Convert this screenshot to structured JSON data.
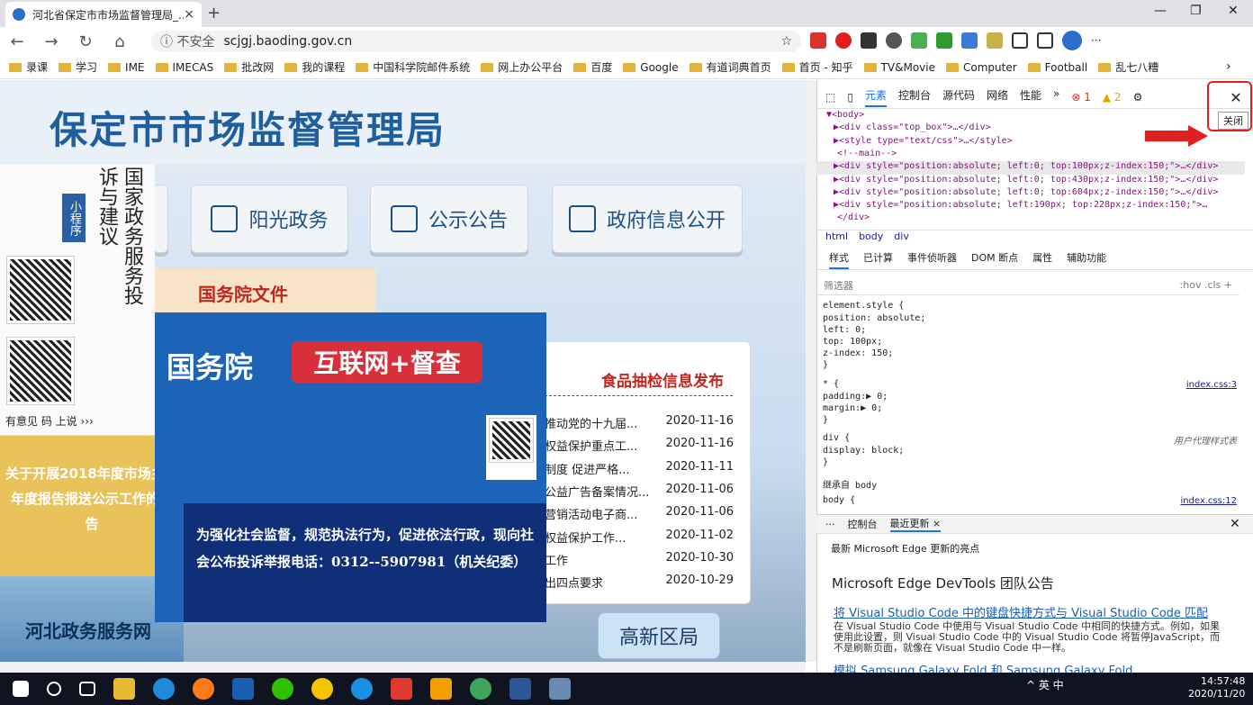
{
  "browser": {
    "tab_title": "河北省保定市市场监督管理局_...",
    "tab_close": "×",
    "new_tab": "+",
    "win_min": "—",
    "win_max": "❐",
    "win_close": "✕",
    "back": "←",
    "forward": "→",
    "refresh": "↻",
    "home": "⌂",
    "insecure": "ⓘ 不安全",
    "url": "scjgj.baoding.gov.cn",
    "star": "☆",
    "more": "···",
    "bookmarks": [
      "录课",
      "学习",
      "IME",
      "IMECAS",
      "批改网",
      "我的课程",
      "中国科学院邮件系统",
      "网上办公平台",
      "百度",
      "Google",
      "有道词典首页",
      "首页 - 知乎",
      "TV&Movie",
      "Computer",
      "Football",
      "乱七八糟"
    ],
    "bookmarks_more": "›"
  },
  "page": {
    "title": "保定市市场监督管理局",
    "nav": [
      "阳光政务",
      "公示公告",
      "政府信息公开"
    ],
    "mini_program": "小程序",
    "left_heading": "国家政务服务投诉与建议",
    "yijian": "有意见  码 上说 ›››",
    "announcement": "关于开展2018年度市场主体年度报告报送公示工作的公告",
    "hebei": "河北政务服务网",
    "gwy_wenjian": "国务院文件",
    "popup_title": "国务院",
    "popup_tag": "互联网+督查",
    "popup_text": "为强化社会监督，规范执法行为，促进依法行政，现向社会公布投诉举报电话：0312--5907981（机关纪委）",
    "news_heading": "食品抽检信息发布",
    "news": [
      {
        "title": "推动党的十九届...",
        "date": "2020-11-16"
      },
      {
        "title": "权益保护重点工...",
        "date": "2020-11-16"
      },
      {
        "title": "制度 促进严格...",
        "date": "2020-11-11"
      },
      {
        "title": "公益广告备案情况...",
        "date": "2020-11-06"
      },
      {
        "title": "营销活动电子商...",
        "date": "2020-11-06"
      },
      {
        "title": "权益保护工作...",
        "date": "2020-11-02"
      },
      {
        "title": "工作",
        "date": "2020-10-30"
      },
      {
        "title": "出四点要求",
        "date": "2020-10-29"
      }
    ],
    "gaoxin": "高新区局"
  },
  "devtools": {
    "tabs": [
      "元素",
      "控制台",
      "源代码",
      "网络",
      "性能",
      "»"
    ],
    "errors": "⊗ 1",
    "warnings": "▲ 2",
    "close_tooltip": "关闭",
    "close": "✕",
    "code": [
      "▼<body>",
      "  ▶<div class=\"top_box\">…</div>",
      "  ▶<style type=\"text/css\">…</style>",
      "   <!--main-->",
      "  ▶<div style=\"position:absolute; left:0; top:100px;z-index:150;\">…</div>",
      "  ▶<div style=\"position:absolute; left:0; top:430px;z-index:150;\">…</div>",
      "  ▶<div style=\"position:absolute; left:0; top:604px;z-index:150;\">…</div>",
      "  ▶<div style=\"position:absolute; left:190px; top:228px;z-index:150;\">…",
      "   </div>"
    ],
    "crumbs": [
      "html",
      "body",
      "div"
    ],
    "style_tabs": [
      "样式",
      "已计算",
      "事件侦听器",
      "DOM 断点",
      "属性",
      "辅助功能"
    ],
    "filter_placeholder": "筛选器",
    "filter_tools": ":hov  .cls  +",
    "css_lines": [
      "element.style {",
      "  position: absolute;",
      "  left: 0;",
      "  top: 100px;",
      "  z-index: 150;",
      "}",
      "* {",
      "  padding:▶ 0;",
      "  margin:▶ 0;",
      "}",
      "div {",
      "  display: block;",
      "}",
      "继承自 body",
      "body {"
    ],
    "css_links": [
      "index.css:3",
      "用户代理样式表",
      "index.css:12"
    ],
    "drawer_tabs": [
      "···",
      "控制台",
      "最近更新 ×"
    ],
    "drawer_close": "✕",
    "whatsnew_sub": "最新 Microsoft Edge 更新的亮点",
    "whatsnew_title": "Microsoft Edge DevTools 团队公告",
    "whatsnew_link1": "将 Visual Studio Code 中的键盘快捷方式与 Visual Studio Code 匹配",
    "whatsnew_desc": "在 Visual Studio Code 中使用与 Visual Studio Code 中相同的快捷方式。例如，如果使用此设置，则 Visual Studio Code 中的 Visual Studio Code 将暂停JavaScript，而不是刷新页面，就像在 Visual Studio Code 中一样。",
    "whatsnew_link2": "模拟 Samsung Galaxy Fold 和 Samsung Galaxy Fold"
  },
  "taskbar": {
    "tray": "^  英  中",
    "time": "14:57:48",
    "date": "2020/11/20"
  }
}
